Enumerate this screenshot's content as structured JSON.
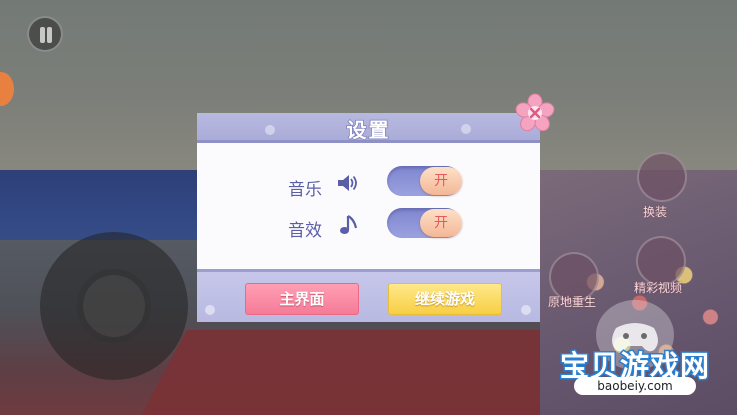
{
  "settings": {
    "title": "设置",
    "music": {
      "label": "音乐",
      "icon": "speaker-icon",
      "state": "开"
    },
    "sfx": {
      "label": "音效",
      "icon": "music-note-icon",
      "state": "开"
    },
    "home_button": "主界面",
    "continue_button": "继续游戏",
    "close_icon": "sakura-close-icon"
  },
  "hud": {
    "outfit_label": "换装",
    "right_label_1": "原地重生",
    "right_label_2": "精彩视频"
  },
  "watermark": {
    "name": "宝贝游戏网",
    "url": "baobeiy.com"
  },
  "colors": {
    "accent": "#5b5fa8",
    "home_button": "#f57b97",
    "continue_button": "#f7cf45",
    "toggle_knob": "#f4b796"
  }
}
